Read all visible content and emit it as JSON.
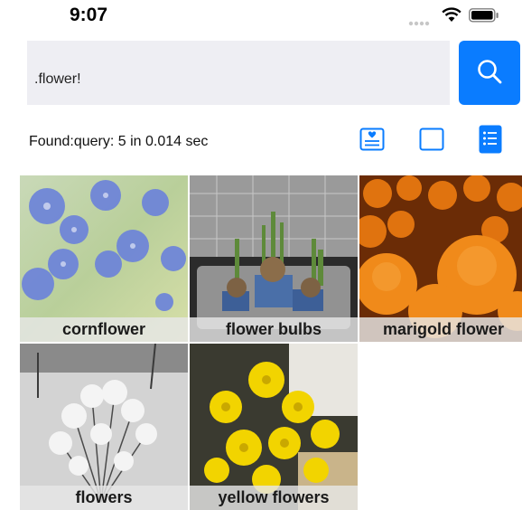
{
  "status_bar": {
    "time": "9:07"
  },
  "search": {
    "query": ".flower!"
  },
  "results": {
    "summary": "Found:query: 5 in 0.014 sec"
  },
  "view_modes": [
    "card-view-icon",
    "single-view-icon",
    "list-view-icon"
  ],
  "photos": [
    {
      "label": "cornflower"
    },
    {
      "label": "flower bulbs"
    },
    {
      "label": "marigold flower"
    },
    {
      "label": "flowers"
    },
    {
      "label": "yellow flowers"
    }
  ],
  "colors": {
    "accent": "#0a7cff",
    "field_bg": "#eeeef3"
  }
}
